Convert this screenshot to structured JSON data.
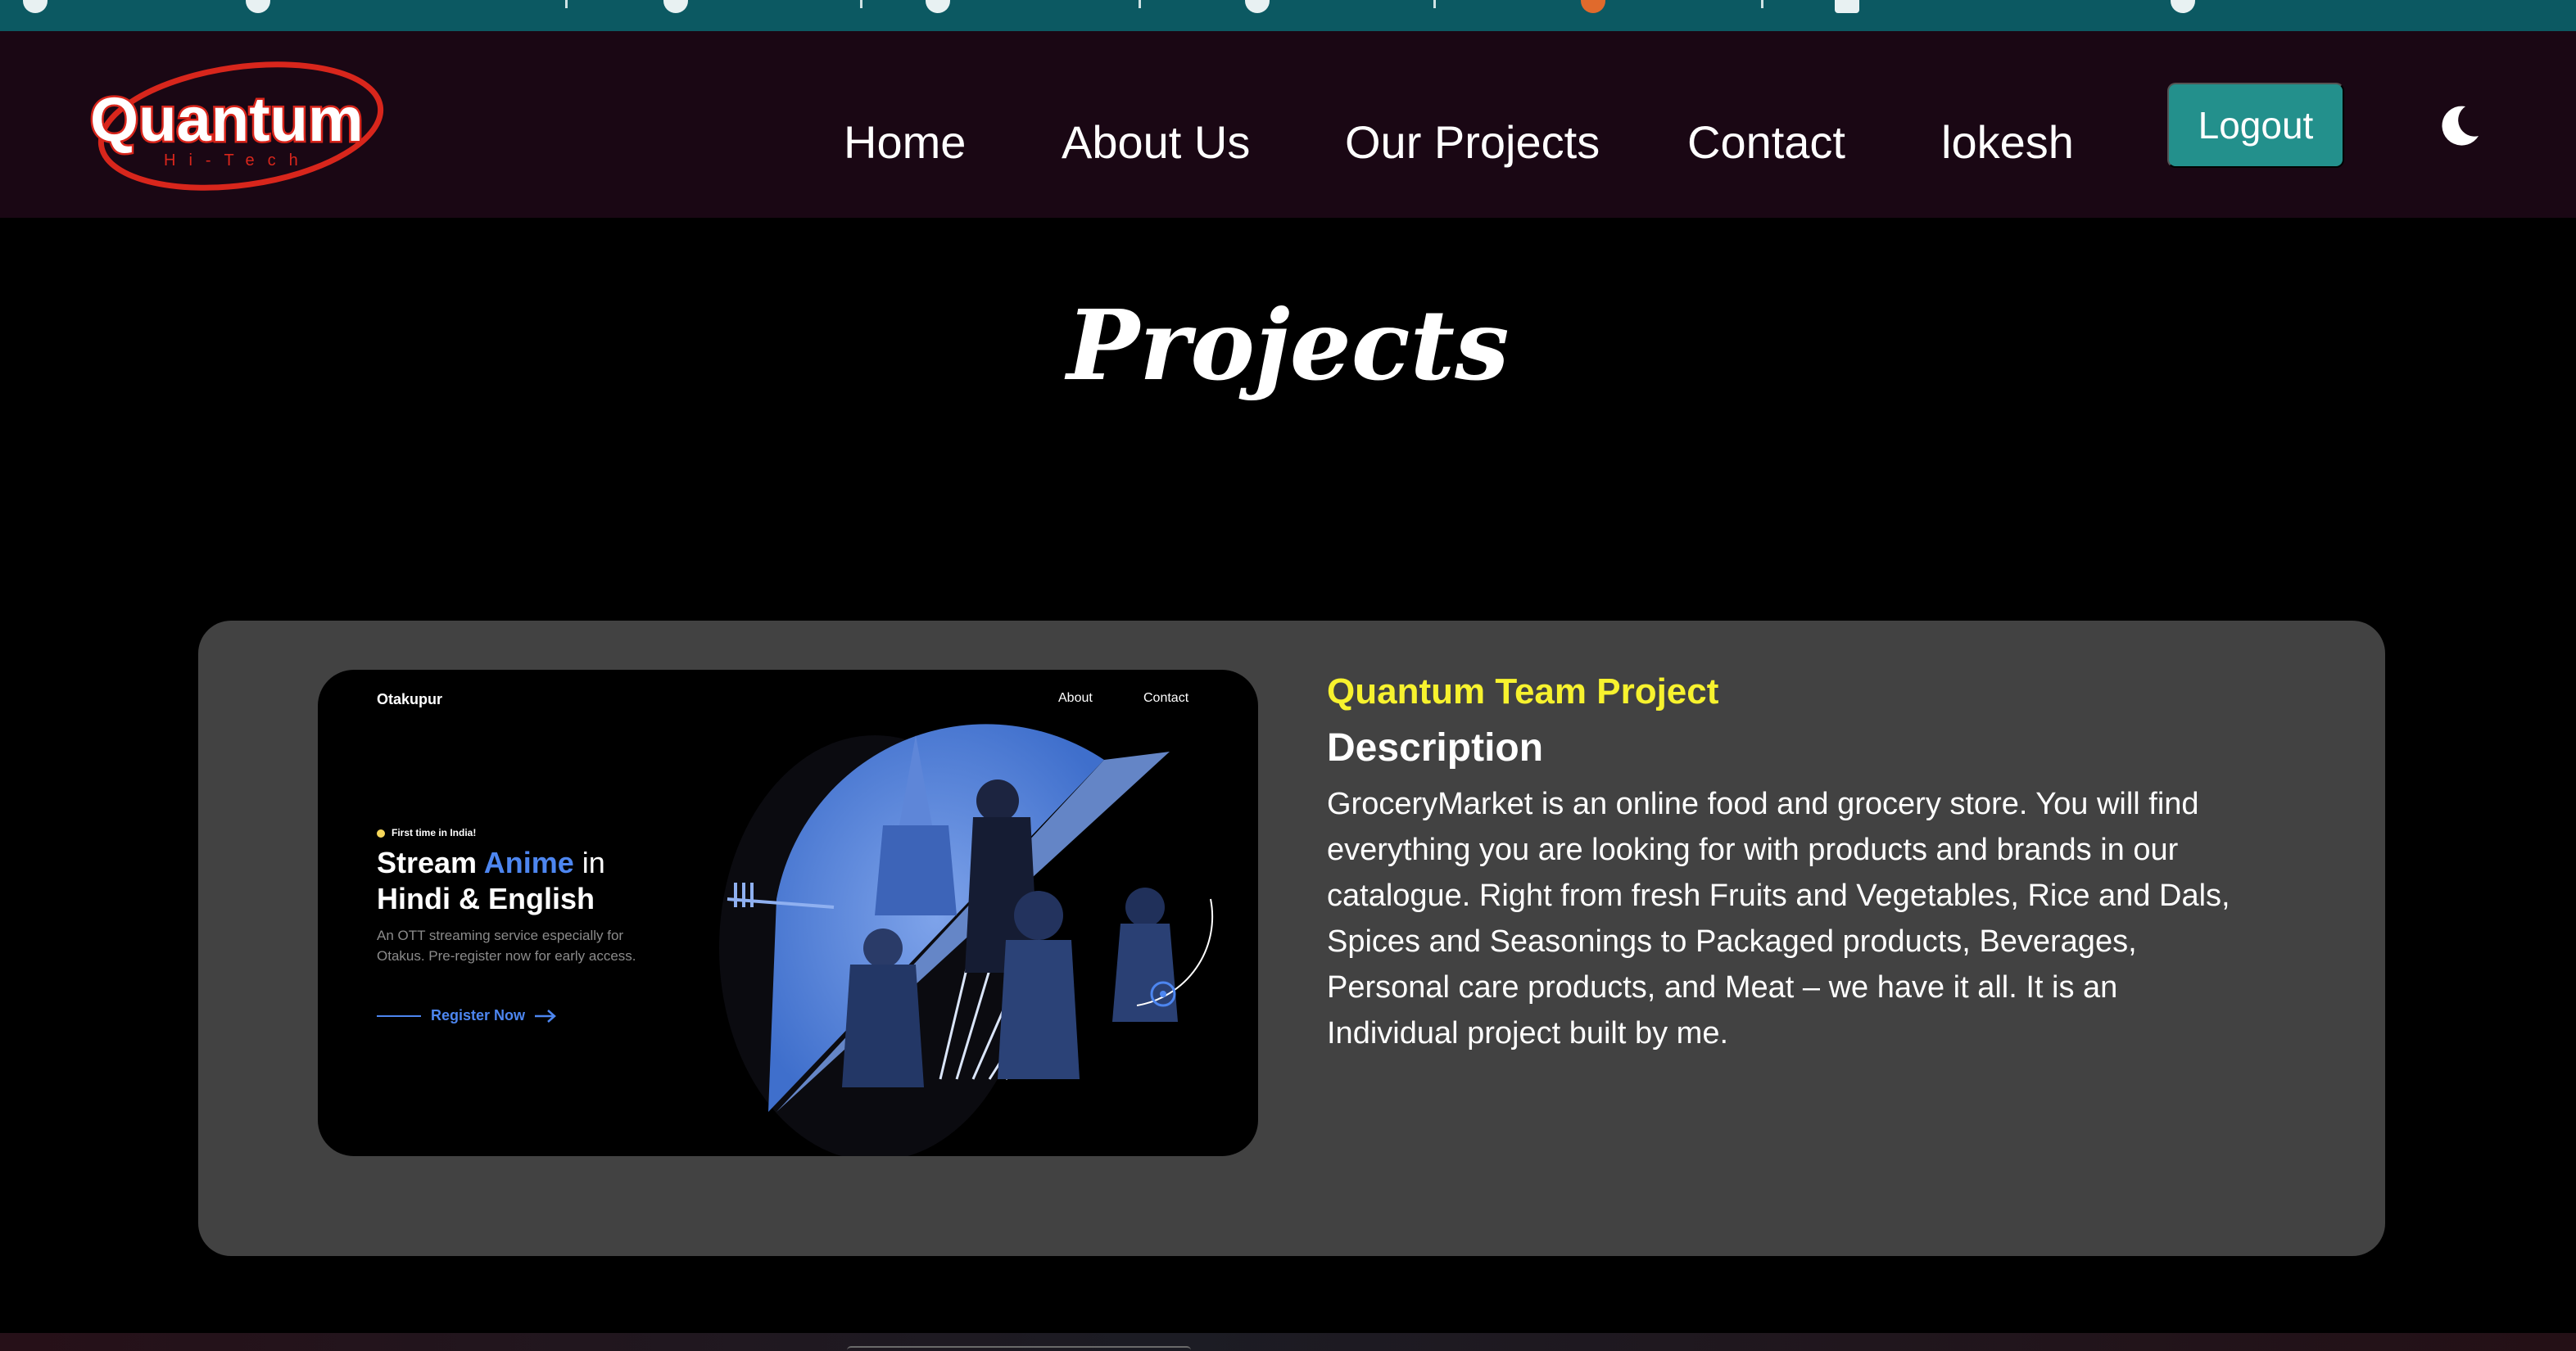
{
  "nav": {
    "brand_alt": "Quantum Hi-Tech",
    "logo_text": "Quantum",
    "logo_subtext": "Hi-Tech",
    "links": [
      "Home",
      "About Us",
      "Our Projects",
      "Contact",
      "lokesh"
    ],
    "logout_label": "Logout",
    "theme_icon": "moon-icon"
  },
  "page": {
    "title": "Projects"
  },
  "project": {
    "title": "Quantum Team Project",
    "description_heading": "Description",
    "description": "GroceryMarket is an online food and grocery store. You will find everything you are looking for with products and brands in our catalogue. Right from fresh Fruits and Vegetables, Rice and Dals, Spices and Seasonings to Packaged products, Beverages, Personal care products, and Meat – we have it all. It is an Individual project built by me.",
    "preview": {
      "brand": "Otakupur",
      "nav_about": "About",
      "nav_contact": "Contact",
      "tag": "First time in India!",
      "head_stream": "Stream ",
      "head_anime": "Anime",
      "head_in": " in",
      "head_line2": "Hindi & English",
      "sub": "An OTT streaming service especially for Otakus. Pre-register now for early access.",
      "cta": "Register Now"
    }
  },
  "colors": {
    "navbar_bg": "#1a0714",
    "accent_teal": "#23908c",
    "project_title": "#f7f22e",
    "card_bg": "#424242",
    "logo_red": "#d8261c",
    "preview_accent": "#4d86f0"
  }
}
